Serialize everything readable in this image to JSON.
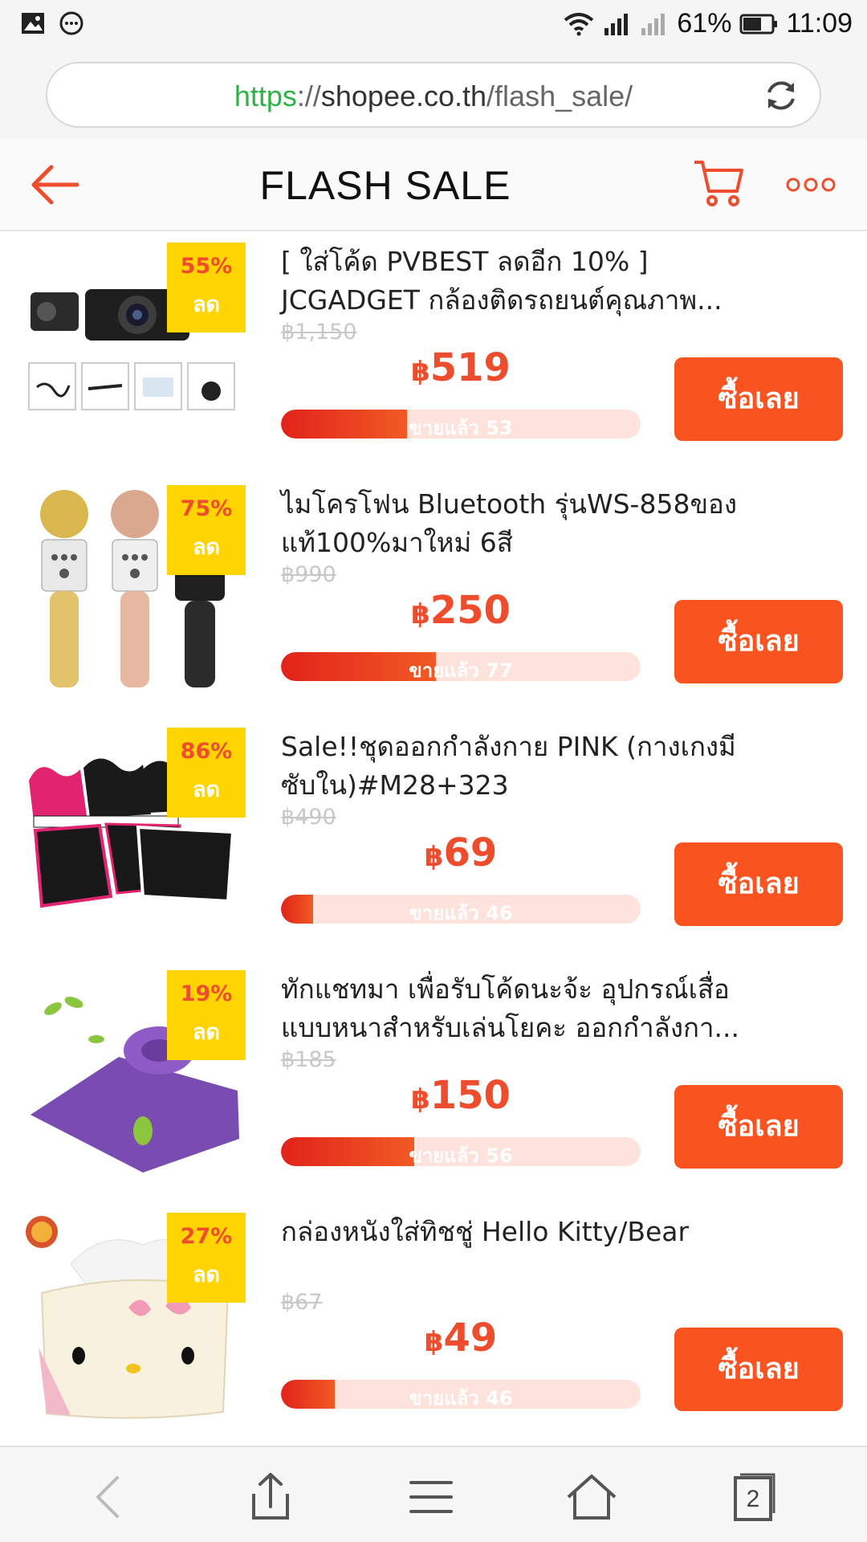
{
  "status_bar": {
    "battery": "61%",
    "time": "11:09",
    "icons": [
      "gallery-icon",
      "messenger-icon",
      "wifi-icon",
      "signal-icon",
      "no-signal-icon",
      "battery-icon"
    ]
  },
  "address_bar": {
    "scheme": "https",
    "separator": "://",
    "host": "shopee.co.th",
    "path": "/flash_sale/"
  },
  "header": {
    "title": "FLASH SALE"
  },
  "colors": {
    "brand": "#ee4d2d",
    "button": "#f9531f",
    "badge": "#ffd400",
    "bar_track": "#fde3db"
  },
  "items": [
    {
      "discount": "55%",
      "discount_word": "ลด",
      "name_line1": "[ ใส่โค้ด PVBEST ลดอีก 10% ]",
      "name_line2": "JCGADGET กล้องติดรถยนต์คุณภาพ...",
      "original_price": "฿1,150",
      "currency": "฿",
      "price": "519",
      "sold_label": "ขายแล้ว 53",
      "sold_progress": 0.35,
      "buy_label": "ซื้อเลย"
    },
    {
      "discount": "75%",
      "discount_word": "ลด",
      "name_line1": "ไมโครโฟน Bluetooth รุ่นWS-858ของ",
      "name_line2": "แท้100%มาใหม่ 6สี",
      "original_price": "฿990",
      "currency": "฿",
      "price": "250",
      "sold_label": "ขายแล้ว 77",
      "sold_progress": 0.43,
      "buy_label": "ซื้อเลย"
    },
    {
      "discount": "86%",
      "discount_word": "ลด",
      "name_line1": "Sale!!ชุดออกกำลังกาย PINK (กางเกงมี",
      "name_line2": "ซับใน)#M28+323",
      "original_price": "฿490",
      "currency": "฿",
      "price": "69",
      "sold_label": "ขายแล้ว 46",
      "sold_progress": 0.09,
      "buy_label": "ซื้อเลย"
    },
    {
      "discount": "19%",
      "discount_word": "ลด",
      "name_line1": "ทักแชทมา เพื่อรับโค้ดนะจ้ะ อุปกรณ์เสื่อ",
      "name_line2": "แบบหนาสำหรับเล่นโยคะ ออกกำลังกา...",
      "original_price": "฿185",
      "currency": "฿",
      "price": "150",
      "sold_label": "ขายแล้ว 56",
      "sold_progress": 0.37,
      "buy_label": "ซื้อเลย"
    },
    {
      "discount": "27%",
      "discount_word": "ลด",
      "name_line1": "กล่องหนังใส่ทิชชู่ Hello Kitty/Bear",
      "name_line2": "",
      "original_price": "฿67",
      "currency": "฿",
      "price": "49",
      "sold_label": "ขายแล้ว 46",
      "sold_progress": 0.15,
      "buy_label": "ซื้อเลย"
    }
  ],
  "bottom_nav": {
    "tab_count": "2",
    "icons": [
      "back-icon",
      "share-icon",
      "menu-icon",
      "home-icon",
      "tabs-icon"
    ]
  }
}
